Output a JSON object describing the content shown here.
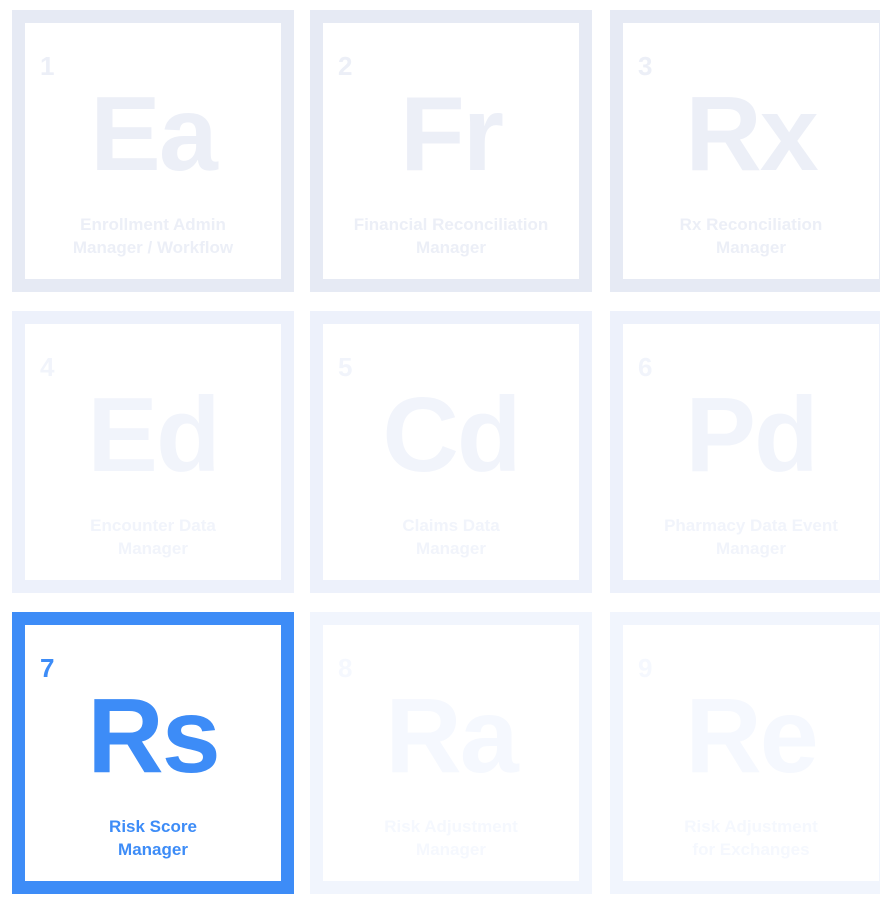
{
  "tiles": [
    {
      "number": "1",
      "symbol": "Ea",
      "name_line1": "Enrollment Admin",
      "name_line2": "Manager / Workflow",
      "active": false
    },
    {
      "number": "2",
      "symbol": "Fr",
      "name_line1": "Financial Reconciliation",
      "name_line2": "Manager",
      "active": false
    },
    {
      "number": "3",
      "symbol": "Rx",
      "name_line1": "Rx Reconciliation",
      "name_line2": "Manager",
      "active": false
    },
    {
      "number": "4",
      "symbol": "Ed",
      "name_line1": "Encounter Data",
      "name_line2": "Manager",
      "active": false
    },
    {
      "number": "5",
      "symbol": "Cd",
      "name_line1": "Claims Data",
      "name_line2": "Manager",
      "active": false
    },
    {
      "number": "6",
      "symbol": "Pd",
      "name_line1": "Pharmacy Data Event",
      "name_line2": "Manager",
      "active": false
    },
    {
      "number": "7",
      "symbol": "Rs",
      "name_line1": "Risk Score",
      "name_line2": "Manager",
      "active": true
    },
    {
      "number": "8",
      "symbol": "Ra",
      "name_line1": "Risk Adjustment",
      "name_line2": "Manager",
      "active": false
    },
    {
      "number": "9",
      "symbol": "Re",
      "name_line1": "Risk Adjustment",
      "name_line2": "for Exchanges",
      "active": false
    }
  ],
  "colors": {
    "active_accent": "#3d8cf7",
    "inactive_border": "#e6eaf4",
    "inactive_text": "#eceff7",
    "background": "#ffffff"
  }
}
